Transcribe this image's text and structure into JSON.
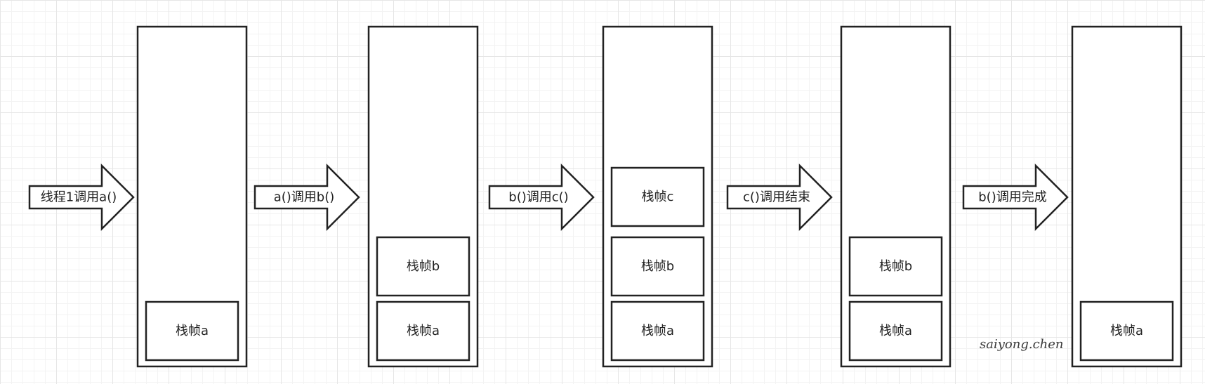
{
  "arrows": [
    {
      "label": "线程1调用a()"
    },
    {
      "label": "a()调用b()"
    },
    {
      "label": "b()调用c()"
    },
    {
      "label": "c()调用结束"
    },
    {
      "label": "b()调用完成"
    }
  ],
  "stacks": [
    {
      "frames": [
        "栈帧a"
      ]
    },
    {
      "frames": [
        "栈帧a",
        "栈帧b"
      ]
    },
    {
      "frames": [
        "栈帧a",
        "栈帧b",
        "栈帧c"
      ]
    },
    {
      "frames": [
        "栈帧a",
        "栈帧b"
      ]
    },
    {
      "frames": [
        "栈帧a"
      ]
    }
  ],
  "watermark": "saiyong.chen"
}
